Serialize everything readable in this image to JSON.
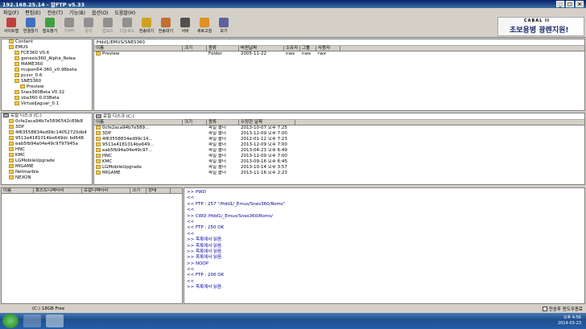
{
  "window": {
    "title": "192.168.25.14 - 알FTP v5.33"
  },
  "menu": [
    "파일(F)",
    "편집(E)",
    "전송(T)",
    "기능(B)",
    "옵션(O)",
    "도움말(H)"
  ],
  "toolbar": [
    {
      "label": "사이트맵",
      "icon": "sitemap-icon",
      "color": "#c04040",
      "enabled": true
    },
    {
      "label": "연결끊기",
      "icon": "disconnect-icon",
      "color": "#4070c0",
      "enabled": true
    },
    {
      "label": "접속정기",
      "icon": "reconnect-icon",
      "color": "#40a040",
      "enabled": true
    },
    {
      "label": "기부터",
      "icon": "upload-icon",
      "color": "#909090",
      "enabled": false
    },
    {
      "label": "중지",
      "icon": "stop-icon",
      "color": "#909090",
      "enabled": false
    },
    {
      "label": "업로드",
      "icon": "upload2-icon",
      "color": "#909090",
      "enabled": false
    },
    {
      "label": "다운로드",
      "icon": "download-icon",
      "color": "#909090",
      "enabled": false
    },
    {
      "label": "전송대기",
      "icon": "queue-icon",
      "color": "#d0a020",
      "enabled": true
    },
    {
      "label": "전송대기",
      "icon": "queue2-icon",
      "color": "#c07030",
      "enabled": true
    },
    {
      "label": "서버",
      "icon": "server-icon",
      "color": "#505050",
      "enabled": true
    },
    {
      "label": "새로고침",
      "icon": "refresh-icon",
      "color": "#e09020",
      "enabled": true
    },
    {
      "label": "보기",
      "icon": "view-icon",
      "color": "#6060a0",
      "enabled": true
    }
  ],
  "ad": {
    "brand": "CABAL II",
    "slogan": "초보용병 광렌지원!"
  },
  "remote_tree": [
    {
      "label": "Content",
      "indent": 1
    },
    {
      "label": "EMUS",
      "indent": 1
    },
    {
      "label": "FCE360 V0.6",
      "indent": 2
    },
    {
      "label": "genesis360_Alpha_Relea",
      "indent": 2
    },
    {
      "label": "MAME360",
      "indent": 2
    },
    {
      "label": "mupen64-360_v0.96beta",
      "indent": 2
    },
    {
      "label": "pcsxr_0.6",
      "indent": 2
    },
    {
      "label": "SNES360",
      "indent": 2
    },
    {
      "label": "Preview",
      "indent": 3
    },
    {
      "label": "Snes360Beta V0.32",
      "indent": 2
    },
    {
      "label": "vba360-0.03Beta",
      "indent": 2
    },
    {
      "label": "VirtualJaguar_0.1",
      "indent": 2
    }
  ],
  "remote": {
    "path": "/Hdd1/EMUS/SNES360",
    "headers": [
      "이름",
      "크기",
      "종류",
      "바뀐날짜",
      "소유자",
      "그룹",
      "사용자"
    ],
    "rows": [
      {
        "name": "Preview",
        "size": "",
        "type": "Folder",
        "date": "2005-11-22",
        "owner": "nwx",
        "group": "nwx",
        "user": "rwx"
      }
    ]
  },
  "local_tree": [
    {
      "label": "로컬 디스크 (C:)",
      "indent": 0,
      "drive": true
    },
    {
      "label": "0cfe2aca94b7e5896542c89b8",
      "indent": 1
    },
    {
      "label": "3DP",
      "indent": 1
    },
    {
      "label": "4f63558834ed99c14052720db4",
      "indent": 1
    },
    {
      "label": "9511e4181014be649dc bd648",
      "indent": 1
    },
    {
      "label": "eab5fb94a04e49c9797945a",
      "indent": 1
    },
    {
      "label": "HNC",
      "indent": 1
    },
    {
      "label": "KMC",
      "indent": 1
    },
    {
      "label": "LGMobileUpgrade",
      "indent": 1
    },
    {
      "label": "MIGAME",
      "indent": 1
    },
    {
      "label": "Netmarble",
      "indent": 1
    },
    {
      "label": "NEXON",
      "indent": 1
    }
  ],
  "local": {
    "path": "로컬 디스크 (C:)",
    "headers": [
      "이름",
      "크기",
      "종류",
      "수정한 날짜"
    ],
    "rows": [
      {
        "name": "0cfe2aca94b7e589...",
        "size": "",
        "type": "파일 폴더",
        "date": "2013-10-07 오후 7:25"
      },
      {
        "name": "3DP",
        "size": "",
        "type": "파일 폴더",
        "date": "2013-12-09 오후 7:00"
      },
      {
        "name": "4f63558834ed99c14...",
        "size": "",
        "type": "파일 폴더",
        "date": "2012-01-12 오후 7:23"
      },
      {
        "name": "9511e4181014be649...",
        "size": "",
        "type": "파일 폴더",
        "date": "2013-12-09 오후 7:00"
      },
      {
        "name": "eab5fb94a04e49c97...",
        "size": "",
        "type": "파일 폴더",
        "date": "2013-04-23 오후 6:49"
      },
      {
        "name": "HNC",
        "size": "",
        "type": "파일 폴더",
        "date": "2013-12-09 오후 7:00"
      },
      {
        "name": "KMC",
        "size": "",
        "type": "파일 폴더",
        "date": "2013-09-16 오후 6:45"
      },
      {
        "name": "LGMobileUpgrade",
        "size": "",
        "type": "파일 폴더",
        "date": "2013-10-14 오후 3:57"
      },
      {
        "name": "MIGAME",
        "size": "",
        "type": "파일 폴더",
        "date": "2013-11-16 오후 2:23"
      }
    ]
  },
  "queue": {
    "headers": [
      "이름",
      "호스트디렉터리",
      "로컬디렉터리",
      "크기",
      "상태"
    ]
  },
  "log": [
    ">> PWD",
    "<<",
    "<< FTP : 257 \"/Hdd1/_Emus/Snes360/Roms\"",
    "<<",
    ">> CWD /Hdd1/_Emus/Snes360/Roms/",
    "<<",
    "<< FTP : 250 OK",
    "<<",
    ">> 목록에서 읽음.",
    ">> 목록에서 읽음.",
    ">> 목록에서 읽음.",
    ">> 목록에서 읽음.",
    ">> NOOP",
    "<<",
    "<< FTP : 200 OK",
    "<<",
    ">> 목록에서 읽음."
  ],
  "status": {
    "drive": "(C:) 18GB Free",
    "shutdown_label": "전송후 윈도우종료"
  },
  "clock": {
    "time": "오후 4:56",
    "date": "2014-03-23"
  }
}
